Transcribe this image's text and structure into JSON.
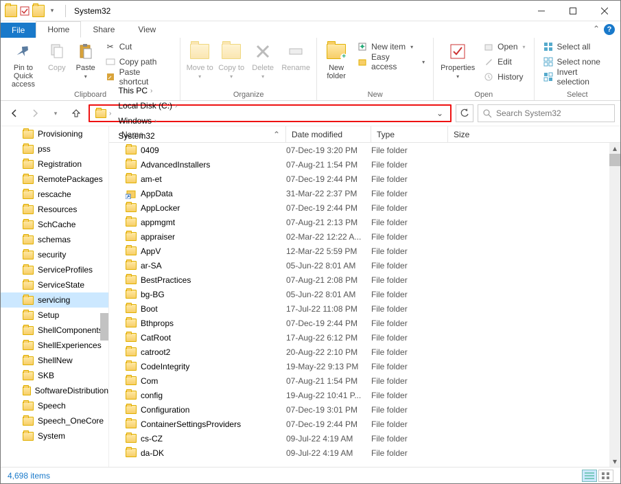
{
  "title": "System32",
  "tabs": {
    "file": "File",
    "home": "Home",
    "share": "Share",
    "view": "View"
  },
  "ribbon": {
    "clipboard": {
      "group": "Clipboard",
      "pin": "Pin to Quick access",
      "copy": "Copy",
      "paste": "Paste",
      "cut": "Cut",
      "copypath": "Copy path",
      "shortcut": "Paste shortcut"
    },
    "organize": {
      "group": "Organize",
      "moveto": "Move to",
      "copyto": "Copy to",
      "delete": "Delete",
      "rename": "Rename"
    },
    "new": {
      "group": "New",
      "newfolder": "New folder",
      "newitem": "New item",
      "easyaccess": "Easy access"
    },
    "open": {
      "group": "Open",
      "properties": "Properties",
      "open": "Open",
      "edit": "Edit",
      "history": "History"
    },
    "select": {
      "group": "Select",
      "all": "Select all",
      "none": "Select none",
      "invert": "Invert selection"
    }
  },
  "path": [
    "This PC",
    "Local Disk (C:)",
    "Windows",
    "System32"
  ],
  "search_placeholder": "Search System32",
  "columns": {
    "name": "Name",
    "date": "Date modified",
    "type": "Type",
    "size": "Size"
  },
  "nav": [
    "Provisioning",
    "pss",
    "Registration",
    "RemotePackages",
    "rescache",
    "Resources",
    "SchCache",
    "schemas",
    "security",
    "ServiceProfiles",
    "ServiceState",
    "servicing",
    "Setup",
    "ShellComponents",
    "ShellExperiences",
    "ShellNew",
    "SKB",
    "SoftwareDistribution",
    "Speech",
    "Speech_OneCore",
    "System"
  ],
  "nav_selected": "servicing",
  "files": [
    {
      "name": "0409",
      "date": "07-Dec-19 3:20 PM",
      "type": "File folder"
    },
    {
      "name": "AdvancedInstallers",
      "date": "07-Aug-21 1:54 PM",
      "type": "File folder"
    },
    {
      "name": "am-et",
      "date": "07-Dec-19 2:44 PM",
      "type": "File folder"
    },
    {
      "name": "AppData",
      "date": "31-Mar-22 2:37 PM",
      "type": "File folder",
      "special": true
    },
    {
      "name": "AppLocker",
      "date": "07-Dec-19 2:44 PM",
      "type": "File folder"
    },
    {
      "name": "appmgmt",
      "date": "07-Aug-21 2:13 PM",
      "type": "File folder"
    },
    {
      "name": "appraiser",
      "date": "02-Mar-22 12:22 A...",
      "type": "File folder"
    },
    {
      "name": "AppV",
      "date": "12-Mar-22 5:59 PM",
      "type": "File folder"
    },
    {
      "name": "ar-SA",
      "date": "05-Jun-22 8:01 AM",
      "type": "File folder"
    },
    {
      "name": "BestPractices",
      "date": "07-Aug-21 2:08 PM",
      "type": "File folder"
    },
    {
      "name": "bg-BG",
      "date": "05-Jun-22 8:01 AM",
      "type": "File folder"
    },
    {
      "name": "Boot",
      "date": "17-Jul-22 11:08 PM",
      "type": "File folder"
    },
    {
      "name": "Bthprops",
      "date": "07-Dec-19 2:44 PM",
      "type": "File folder"
    },
    {
      "name": "CatRoot",
      "date": "17-Aug-22 6:12 PM",
      "type": "File folder"
    },
    {
      "name": "catroot2",
      "date": "20-Aug-22 2:10 PM",
      "type": "File folder"
    },
    {
      "name": "CodeIntegrity",
      "date": "19-May-22 9:13 PM",
      "type": "File folder"
    },
    {
      "name": "Com",
      "date": "07-Aug-21 1:54 PM",
      "type": "File folder"
    },
    {
      "name": "config",
      "date": "19-Aug-22 10:41 P...",
      "type": "File folder"
    },
    {
      "name": "Configuration",
      "date": "07-Dec-19 3:01 PM",
      "type": "File folder"
    },
    {
      "name": "ContainerSettingsProviders",
      "date": "07-Dec-19 2:44 PM",
      "type": "File folder"
    },
    {
      "name": "cs-CZ",
      "date": "09-Jul-22 4:19 AM",
      "type": "File folder"
    },
    {
      "name": "da-DK",
      "date": "09-Jul-22 4:19 AM",
      "type": "File folder"
    }
  ],
  "status": "4,698 items"
}
